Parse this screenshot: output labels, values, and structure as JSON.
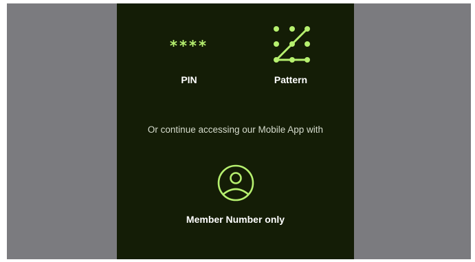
{
  "login_options": {
    "pin": {
      "label": "PIN",
      "icon_text": "****",
      "icon": "pin-dots-icon"
    },
    "pattern": {
      "label": "Pattern",
      "icon": "pattern-grid-icon"
    }
  },
  "alternate": {
    "prompt": "Or continue accessing our Mobile App with",
    "member": {
      "label": "Member Number only",
      "icon": "user-circle-icon"
    }
  },
  "colors": {
    "background": "#141d06",
    "accent": "#b6f06f",
    "surround": "#7b7b7f",
    "text": "#ffffff"
  }
}
